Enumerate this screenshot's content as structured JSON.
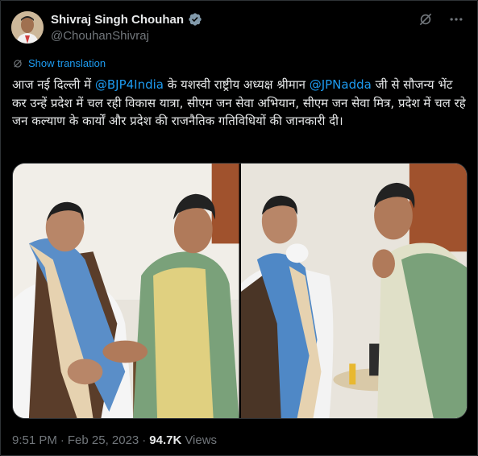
{
  "author": {
    "display_name": "Shivraj Singh Chouhan",
    "handle": "@ChouhanShivraj",
    "verified_icon": "verified-badge-icon"
  },
  "actions": {
    "grok_icon": "grok-icon",
    "more_icon": "more-icon"
  },
  "translate": {
    "label": "Show translation",
    "icon": "globe-translate-icon"
  },
  "tweet": {
    "text_part1": "आज नई दिल्ली में ",
    "mention1": "@BJP4India",
    "text_part2": " के यशस्वी राष्ट्रीय अध्यक्ष श्रीमान ",
    "mention2": "@JPNadda",
    "text_part3": " जी से सौजन्य भेंट कर उन्हें प्रदेश में चल रही विकास यात्रा, सीएम जन सेवा अभियान, सीएम जन सेवा मित्र, प्रदेश में चल रहे जन कल्याण के कार्यों और प्रदेश की राजनैतिक गतिविधियों की जानकारी दी।"
  },
  "meta": {
    "time": "9:51 PM",
    "sep1": "·",
    "date": "Feb 25, 2023",
    "sep2": "·",
    "views_count": "94.7K",
    "views_label": "Views"
  },
  "colors": {
    "background": "#000000",
    "text": "#e7e9ea",
    "secondary": "#71767b",
    "accent": "#1d9bf0",
    "border": "#2f3336"
  }
}
